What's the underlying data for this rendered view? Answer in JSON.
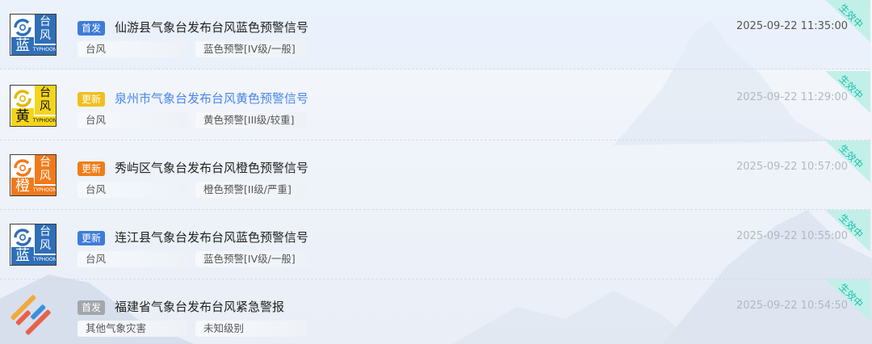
{
  "ribbon_text": "生效中",
  "icon_common": {
    "right_text": "台\n风",
    "typhoon_label": "TYPHOON"
  },
  "rows": [
    {
      "icon": {
        "type": "typhoon",
        "level_char": "蓝",
        "color": "#2f6fb8",
        "left_bg": "#2f6fb8",
        "swirl_color": "#2f6fb8"
      },
      "tag": {
        "text": "首发",
        "color": "#3d7cd9"
      },
      "title": "仙游县气象台发布台风蓝色预警信号",
      "title_link": false,
      "category": "台风",
      "level": "蓝色预警[IV级/一般]",
      "time": "2025-09-22 11:35:00",
      "time_color": "#555555",
      "highlighted": true
    },
    {
      "icon": {
        "type": "typhoon",
        "level_char": "黄",
        "color": "#f4d51c",
        "left_bg": "#f4d51c",
        "swirl_color": "#e0b800"
      },
      "tag": {
        "text": "更新",
        "color": "#f2be1d"
      },
      "title": "泉州市气象台发布台风黄色预警信号",
      "title_link": true,
      "category": "台风",
      "level": "黄色预警[III级/较重]",
      "time": "2025-09-22 11:29:00",
      "time_color": "#b3b8c2",
      "highlighted": false
    },
    {
      "icon": {
        "type": "typhoon",
        "level_char": "橙",
        "color": "#f07a1b",
        "left_bg": "#f07a1b",
        "swirl_color": "#f07a1b"
      },
      "tag": {
        "text": "更新",
        "color": "#f07d16"
      },
      "title": "秀屿区气象台发布台风橙色预警信号",
      "title_link": false,
      "category": "台风",
      "level": "橙色预警[II级/严重]",
      "time": "2025-09-22 10:57:00",
      "time_color": "#b3b8c2",
      "highlighted": false
    },
    {
      "icon": {
        "type": "typhoon",
        "level_char": "蓝",
        "color": "#2f6fb8",
        "left_bg": "#2f6fb8",
        "swirl_color": "#2f6fb8"
      },
      "tag": {
        "text": "更新",
        "color": "#3d7cd9"
      },
      "title": "连江县气象台发布台风蓝色预警信号",
      "title_link": false,
      "category": "台风",
      "level": "蓝色预警[IV级/一般]",
      "time": "2025-09-22 10:55:00",
      "time_color": "#b3b8c2",
      "highlighted": false
    },
    {
      "icon": {
        "type": "logo",
        "color": "#e9604a"
      },
      "tag": {
        "text": "首发",
        "color": "#a3a6ab"
      },
      "title": "福建省气象台发布台风紧急警报",
      "title_link": false,
      "category": "其他气象灾害",
      "level": "未知级别",
      "time": "2025-09-22 10:54:50",
      "time_color": "#b3b8c2",
      "highlighted": false
    }
  ]
}
